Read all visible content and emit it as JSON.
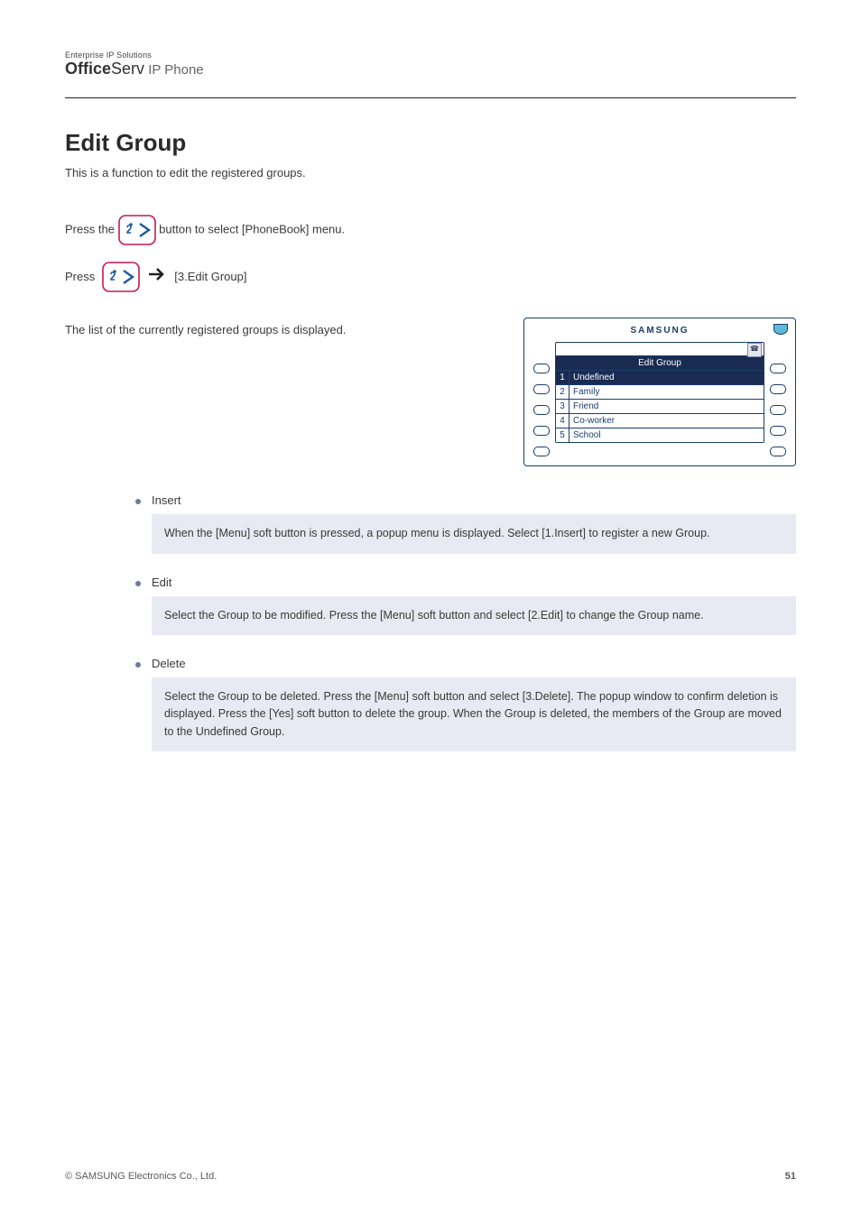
{
  "brand": {
    "topline": "Enterprise IP Solutions",
    "bold": "Office",
    "mid": "Serv",
    "suffix": " IP Phone"
  },
  "section": {
    "title": "Edit Group",
    "intro": "This is a function to edit the registered groups.",
    "step1_a": "Press the ",
    "step1_b": " button to select [PhoneBook] menu.",
    "step2_a": "Press ",
    "step2_b": "[3.Edit Group]",
    "step3": "The list of the currently registered groups is displayed."
  },
  "lcd": {
    "brand": "SAMSUNG",
    "title": "Edit Group",
    "rows": [
      {
        "n": "1",
        "label": "Undefined"
      },
      {
        "n": "2",
        "label": "Family"
      },
      {
        "n": "3",
        "label": "Friend"
      },
      {
        "n": "4",
        "label": "Co-worker"
      },
      {
        "n": "5",
        "label": "School"
      }
    ]
  },
  "ops": {
    "insert": {
      "title": "Insert",
      "body": "When the [Menu] soft button is pressed, a popup menu is displayed. Select [1.Insert] to register a new Group."
    },
    "edit": {
      "title": "Edit",
      "body": "Select the Group to be modified. Press the [Menu] soft button and select [2.Edit] to change the Group name."
    },
    "delete": {
      "title": "Delete",
      "body": "Select the Group to be deleted. Press the [Menu] soft button and select [3.Delete]. The popup window to confirm deletion is displayed. Press the [Yes] soft button to delete the group. When the Group is deleted, the members of the Group are moved to the Undefined Group."
    }
  },
  "footer": {
    "copy": "© SAMSUNG Electronics Co., Ltd.",
    "page": "51"
  }
}
